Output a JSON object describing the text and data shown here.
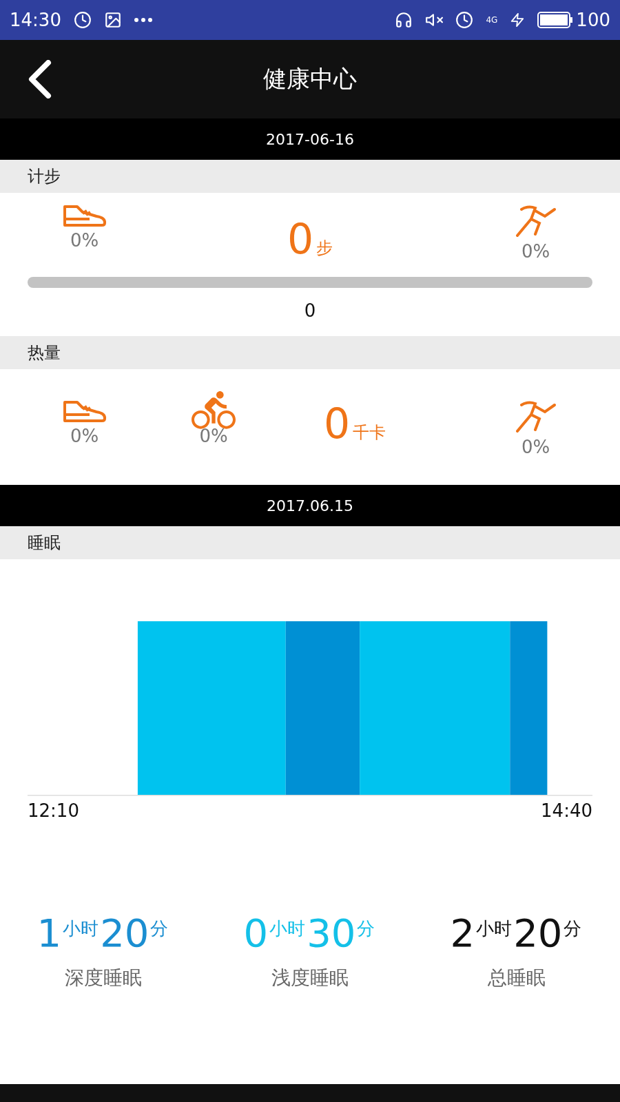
{
  "status_bar": {
    "time": "14:30",
    "battery": "100",
    "network": "4G"
  },
  "header": {
    "title": "健康中心"
  },
  "steps_date": "2017-06-16",
  "steps": {
    "title": "计步",
    "walk_percent": "0%",
    "total": "0",
    "unit": "步",
    "run_percent": "0%",
    "level": 0,
    "progress_value": "0"
  },
  "calories": {
    "title": "热量",
    "walk_percent": "0%",
    "bike_percent": "0%",
    "total": "0",
    "unit": "千卡",
    "run_percent": "0%"
  },
  "sleep_date": "2017.06.15",
  "sleep": {
    "title": "睡眠",
    "start": "12:10",
    "end": "14:40",
    "stats": [
      {
        "kind": "deep",
        "hours": "1",
        "hours_unit": "小时",
        "minutes": "20",
        "minutes_unit": "分",
        "label": "深度睡眠"
      },
      {
        "kind": "light",
        "hours": "0",
        "hours_unit": "小时",
        "minutes": "30",
        "minutes_unit": "分",
        "label": "浅度睡眠"
      },
      {
        "kind": "total",
        "hours": "2",
        "hours_unit": "小时",
        "minutes": "20",
        "minutes_unit": "分",
        "label": "总睡眠"
      }
    ]
  }
}
